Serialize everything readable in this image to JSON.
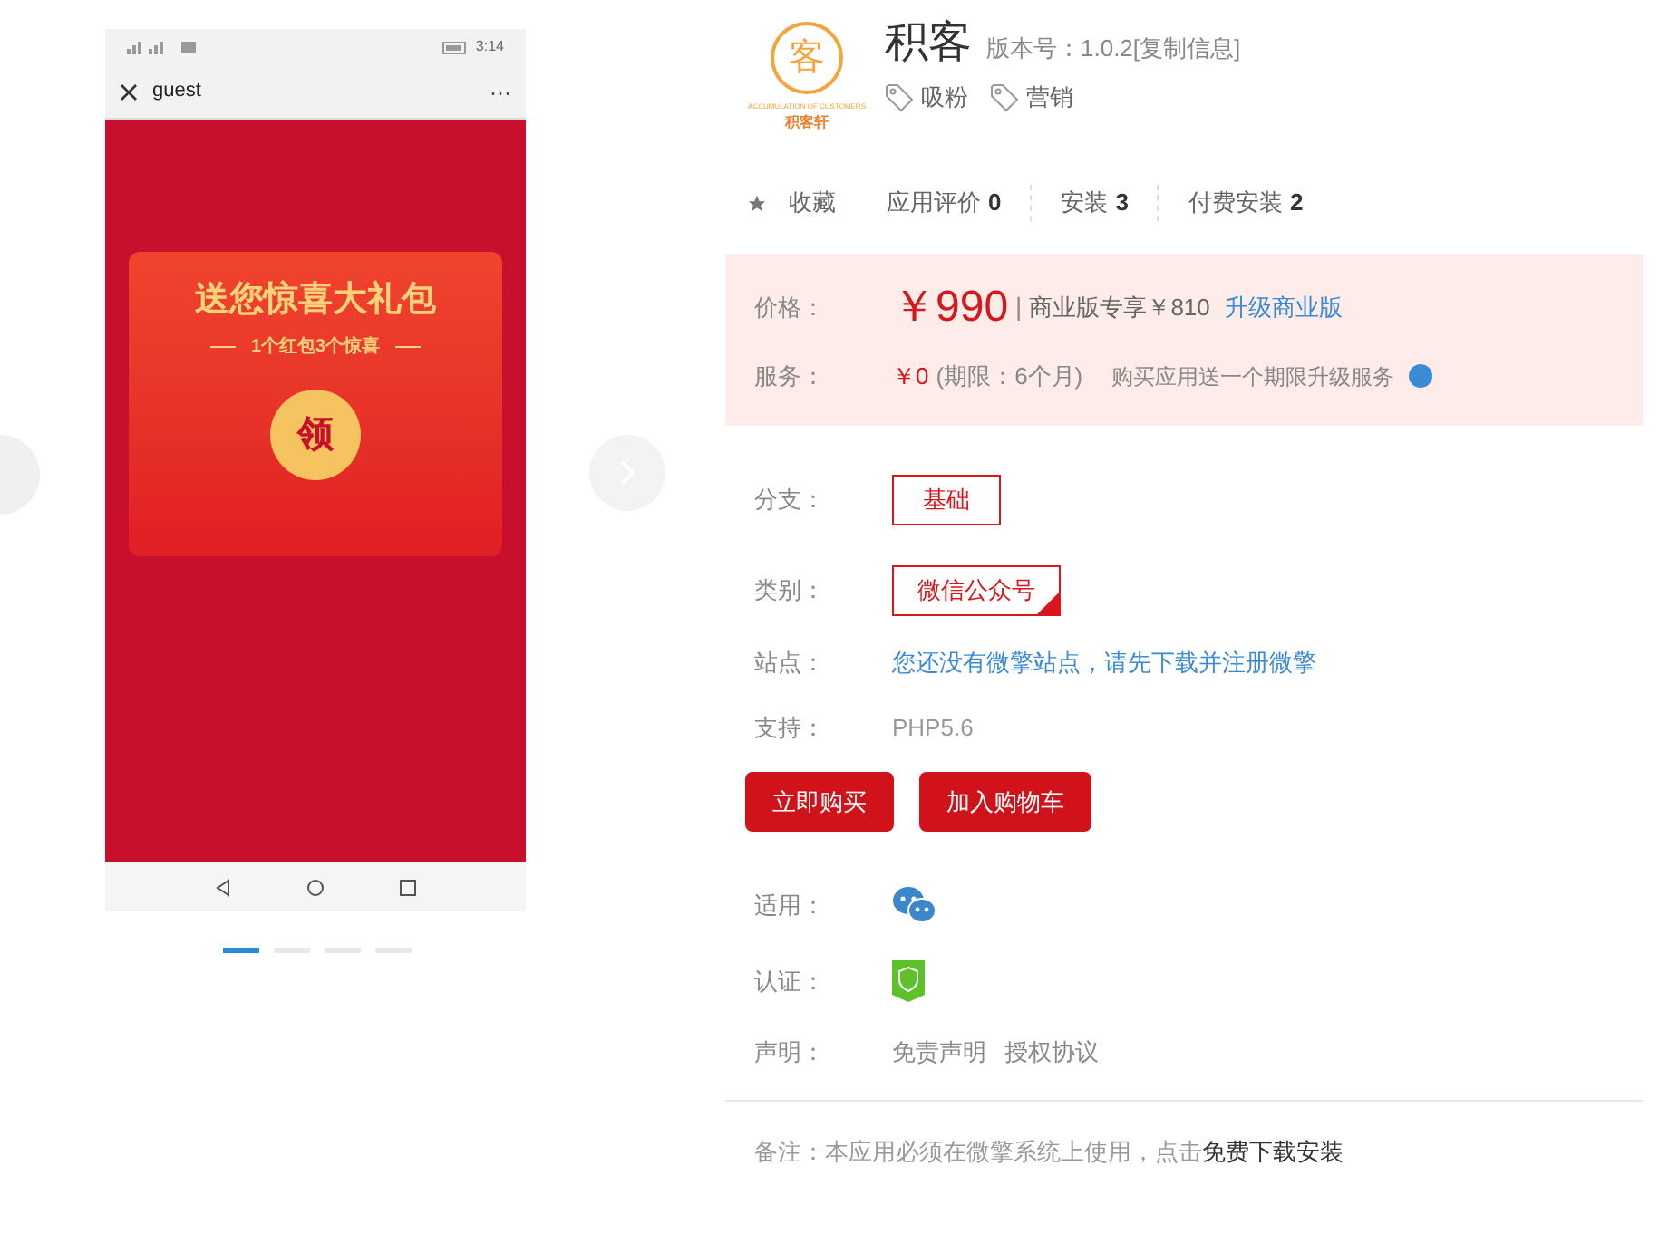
{
  "phone": {
    "status_time": "3:14",
    "title": "guest",
    "more": "···",
    "banner": {
      "headline": "送您惊喜大礼包",
      "subline": "1个红包3个惊喜",
      "claim": "领"
    }
  },
  "carousel_dots": [
    {
      "selected": true
    },
    {
      "selected": false
    },
    {
      "selected": false
    },
    {
      "selected": false
    }
  ],
  "app": {
    "logo_caption": "ACCUMULATION OF CUSTOMERS",
    "logo_brand": "积客轩",
    "logo_char": "客",
    "name": "积客",
    "version": "版本号：1.0.2",
    "copy_link": "[复制信息]",
    "tags": [
      "吸粉",
      "营销"
    ]
  },
  "stats": [
    {
      "kind": "favorite",
      "label": "收藏"
    },
    {
      "kind": "count",
      "label": "应用评价",
      "value": "0"
    },
    {
      "kind": "count",
      "label": "安装",
      "value": "3"
    },
    {
      "kind": "count",
      "label": "付费安装",
      "value": "2"
    }
  ],
  "price": {
    "label": "价格：",
    "amount": "￥990",
    "separator": "|",
    "business": "商业版专享￥810",
    "upgrade_link": "升级商业版"
  },
  "service": {
    "label": "服务：",
    "amount": "￥0",
    "period": "(期限：6个月)",
    "note": "购买应用送一个期限升级服务"
  },
  "branch": {
    "label": "分支：",
    "options": [
      {
        "label": "基础",
        "selected": false
      }
    ]
  },
  "category": {
    "label": "类别：",
    "options": [
      {
        "label": "微信公众号",
        "selected": true
      }
    ]
  },
  "site": {
    "label": "站点：",
    "text": "您还没有微擎站点，",
    "link": "请先下载并注册微擎"
  },
  "support": {
    "label": "支持：",
    "value": "PHP5.6"
  },
  "buttons": [
    "立即购买",
    "加入购物车"
  ],
  "platform": {
    "label": "适用："
  },
  "certification": {
    "label": "认证："
  },
  "statement": {
    "label": "声明：",
    "links": [
      "免责声明",
      "授权协议"
    ]
  },
  "note": {
    "text": "备注：本应用必须在微擎系统上使用，点击",
    "link": "免费下载安装"
  }
}
